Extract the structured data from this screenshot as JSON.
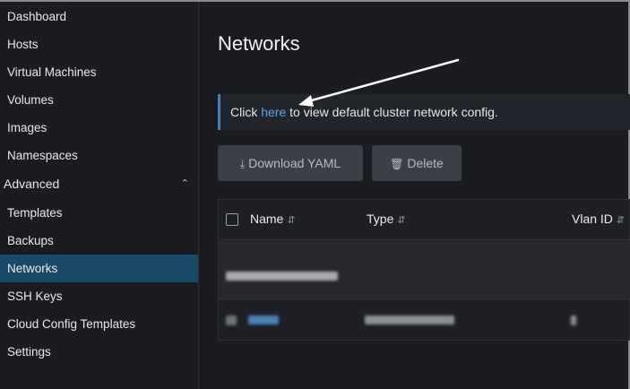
{
  "sidebar": {
    "items": [
      {
        "label": "Dashboard"
      },
      {
        "label": "Hosts"
      },
      {
        "label": "Virtual Machines"
      },
      {
        "label": "Volumes"
      },
      {
        "label": "Images"
      },
      {
        "label": "Namespaces"
      }
    ],
    "group": {
      "label": "Advanced",
      "expanded": true
    },
    "advanced_items": [
      {
        "label": "Templates"
      },
      {
        "label": "Backups"
      },
      {
        "label": "Networks",
        "active": true
      },
      {
        "label": "SSH Keys"
      },
      {
        "label": "Cloud Config Templates"
      },
      {
        "label": "Settings"
      }
    ]
  },
  "main": {
    "title": "Networks",
    "banner": {
      "prefix": "Click ",
      "link": "here",
      "suffix": " to view default cluster network config."
    },
    "buttons": {
      "download": "Download YAML",
      "delete": "Delete"
    },
    "table": {
      "columns": [
        "Name",
        "Type",
        "Vlan ID"
      ]
    }
  },
  "colors": {
    "active_nav": "#1a4a6a",
    "link": "#5ba6e6",
    "banner_accent": "#3d84bf",
    "background": "#1b1c21"
  },
  "icons": {
    "download": "download-icon",
    "delete": "trash-icon",
    "group_toggle": "chevron-up-icon",
    "sort": "sort-icon"
  }
}
